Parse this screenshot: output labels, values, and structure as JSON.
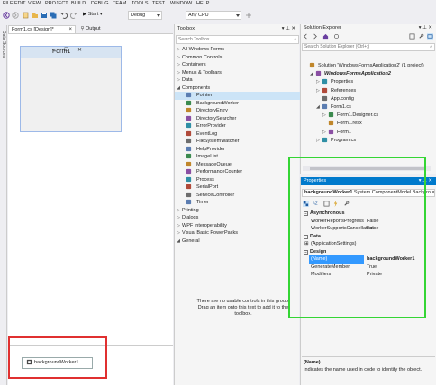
{
  "menu": [
    "FILE",
    "EDIT",
    "VIEW",
    "PROJECT",
    "BUILD",
    "DEBUG",
    "TEAM",
    "TOOLS",
    "TEST",
    "WINDOW",
    "HELP"
  ],
  "toolbar": {
    "start_label": "▶ Start ▾",
    "config_value": "Debug",
    "platform_value": "Any CPU"
  },
  "left_strip": {
    "label": "Data Sources"
  },
  "doc_tabs": {
    "designer_tab": "Form1.cs [Design]*",
    "output_tab": "Output"
  },
  "designer": {
    "form_title": "Form1",
    "component_tray": [
      {
        "label": "backgroundWorker1",
        "icon": "background-worker-icon"
      }
    ]
  },
  "toolbox": {
    "title": "Toolbox",
    "search_placeholder": "Search Toolbox",
    "groups_top": [
      {
        "label": "All Windows Forms",
        "expanded": false
      },
      {
        "label": "Common Controls",
        "expanded": false
      },
      {
        "label": "Containers",
        "expanded": false
      },
      {
        "label": "Menus & Toolbars",
        "expanded": false
      },
      {
        "label": "Data",
        "expanded": false
      },
      {
        "label": "Components",
        "expanded": true
      }
    ],
    "component_items": [
      {
        "label": "Pointer",
        "icon": "pointer-icon",
        "selected": true
      },
      {
        "label": "BackgroundWorker",
        "icon": "background-worker-icon"
      },
      {
        "label": "DirectoryEntry",
        "icon": "directory-entry-icon"
      },
      {
        "label": "DirectorySearcher",
        "icon": "directory-searcher-icon"
      },
      {
        "label": "ErrorProvider",
        "icon": "error-provider-icon"
      },
      {
        "label": "EventLog",
        "icon": "event-log-icon"
      },
      {
        "label": "FileSystemWatcher",
        "icon": "file-system-watcher-icon"
      },
      {
        "label": "HelpProvider",
        "icon": "help-provider-icon"
      },
      {
        "label": "ImageList",
        "icon": "image-list-icon"
      },
      {
        "label": "MessageQueue",
        "icon": "message-queue-icon"
      },
      {
        "label": "PerformanceCounter",
        "icon": "performance-counter-icon"
      },
      {
        "label": "Process",
        "icon": "process-icon"
      },
      {
        "label": "SerialPort",
        "icon": "serial-port-icon"
      },
      {
        "label": "ServiceController",
        "icon": "service-controller-icon"
      },
      {
        "label": "Timer",
        "icon": "timer-icon"
      }
    ],
    "groups_bottom": [
      {
        "label": "Printing",
        "expanded": false
      },
      {
        "label": "Dialogs",
        "expanded": false
      },
      {
        "label": "WPF Interoperability",
        "expanded": false
      },
      {
        "label": "Visual Basic PowerPacks",
        "expanded": false
      },
      {
        "label": "General",
        "expanded": true
      }
    ],
    "general_message": "There are no usable controls in this group. Drag an item onto this text to add it to the toolbox."
  },
  "solution_explorer": {
    "title": "Solution Explorer",
    "search_placeholder": "Search Solution Explorer (Ctrl+;)",
    "items": [
      {
        "label": "Solution 'WindowsFormsApplication2' (1 project)",
        "icon": "solution-icon",
        "level": 0,
        "arrow": ""
      },
      {
        "label": "WindowsFormsApplication2",
        "icon": "csharp-project-icon",
        "level": 1,
        "arrow": "◢",
        "bold": true
      },
      {
        "label": "Properties",
        "icon": "wrench-icon",
        "level": 2,
        "arrow": "▷"
      },
      {
        "label": "References",
        "icon": "references-icon",
        "level": 2,
        "arrow": "▷"
      },
      {
        "label": "App.config",
        "icon": "config-file-icon",
        "level": 2,
        "arrow": ""
      },
      {
        "label": "Form1.cs",
        "icon": "form-icon",
        "level": 2,
        "arrow": "◢"
      },
      {
        "label": "Form1.Designer.cs",
        "icon": "csharp-file-icon",
        "level": 3,
        "arrow": "▷"
      },
      {
        "label": "Form1.resx",
        "icon": "resx-file-icon",
        "level": 3,
        "arrow": ""
      },
      {
        "label": "Form1",
        "icon": "class-icon",
        "level": 3,
        "arrow": "▷"
      },
      {
        "label": "Program.cs",
        "icon": "csharp-file-icon",
        "level": 2,
        "arrow": "▷"
      }
    ]
  },
  "properties": {
    "title": "Properties",
    "object_name": "backgroundWorker1",
    "object_type": "System.ComponentModel.BackgroundWorker",
    "rows": [
      {
        "kind": "cat",
        "name": "Asynchronous"
      },
      {
        "kind": "prop",
        "name": "WorkerReportsProgress",
        "value": "False"
      },
      {
        "kind": "prop",
        "name": "WorkerSupportsCancellation",
        "value": "False"
      },
      {
        "kind": "cat",
        "name": "Data"
      },
      {
        "kind": "prop",
        "name": "(ApplicationSettings)",
        "value": "",
        "expandable": true
      },
      {
        "kind": "cat",
        "name": "Design"
      },
      {
        "kind": "prop",
        "name": "(Name)",
        "value": "backgroundWorker1",
        "selected": true
      },
      {
        "kind": "prop",
        "name": "GenerateMember",
        "value": "True"
      },
      {
        "kind": "prop",
        "name": "Modifiers",
        "value": "Private"
      }
    ],
    "description_name": "(Name)",
    "description_text": "Indicates the name used in code to identify the object."
  },
  "colors": {
    "accent": "#007acc",
    "highlight_red": "#e03030",
    "highlight_green": "#34d534",
    "selection": "#3399ff"
  }
}
